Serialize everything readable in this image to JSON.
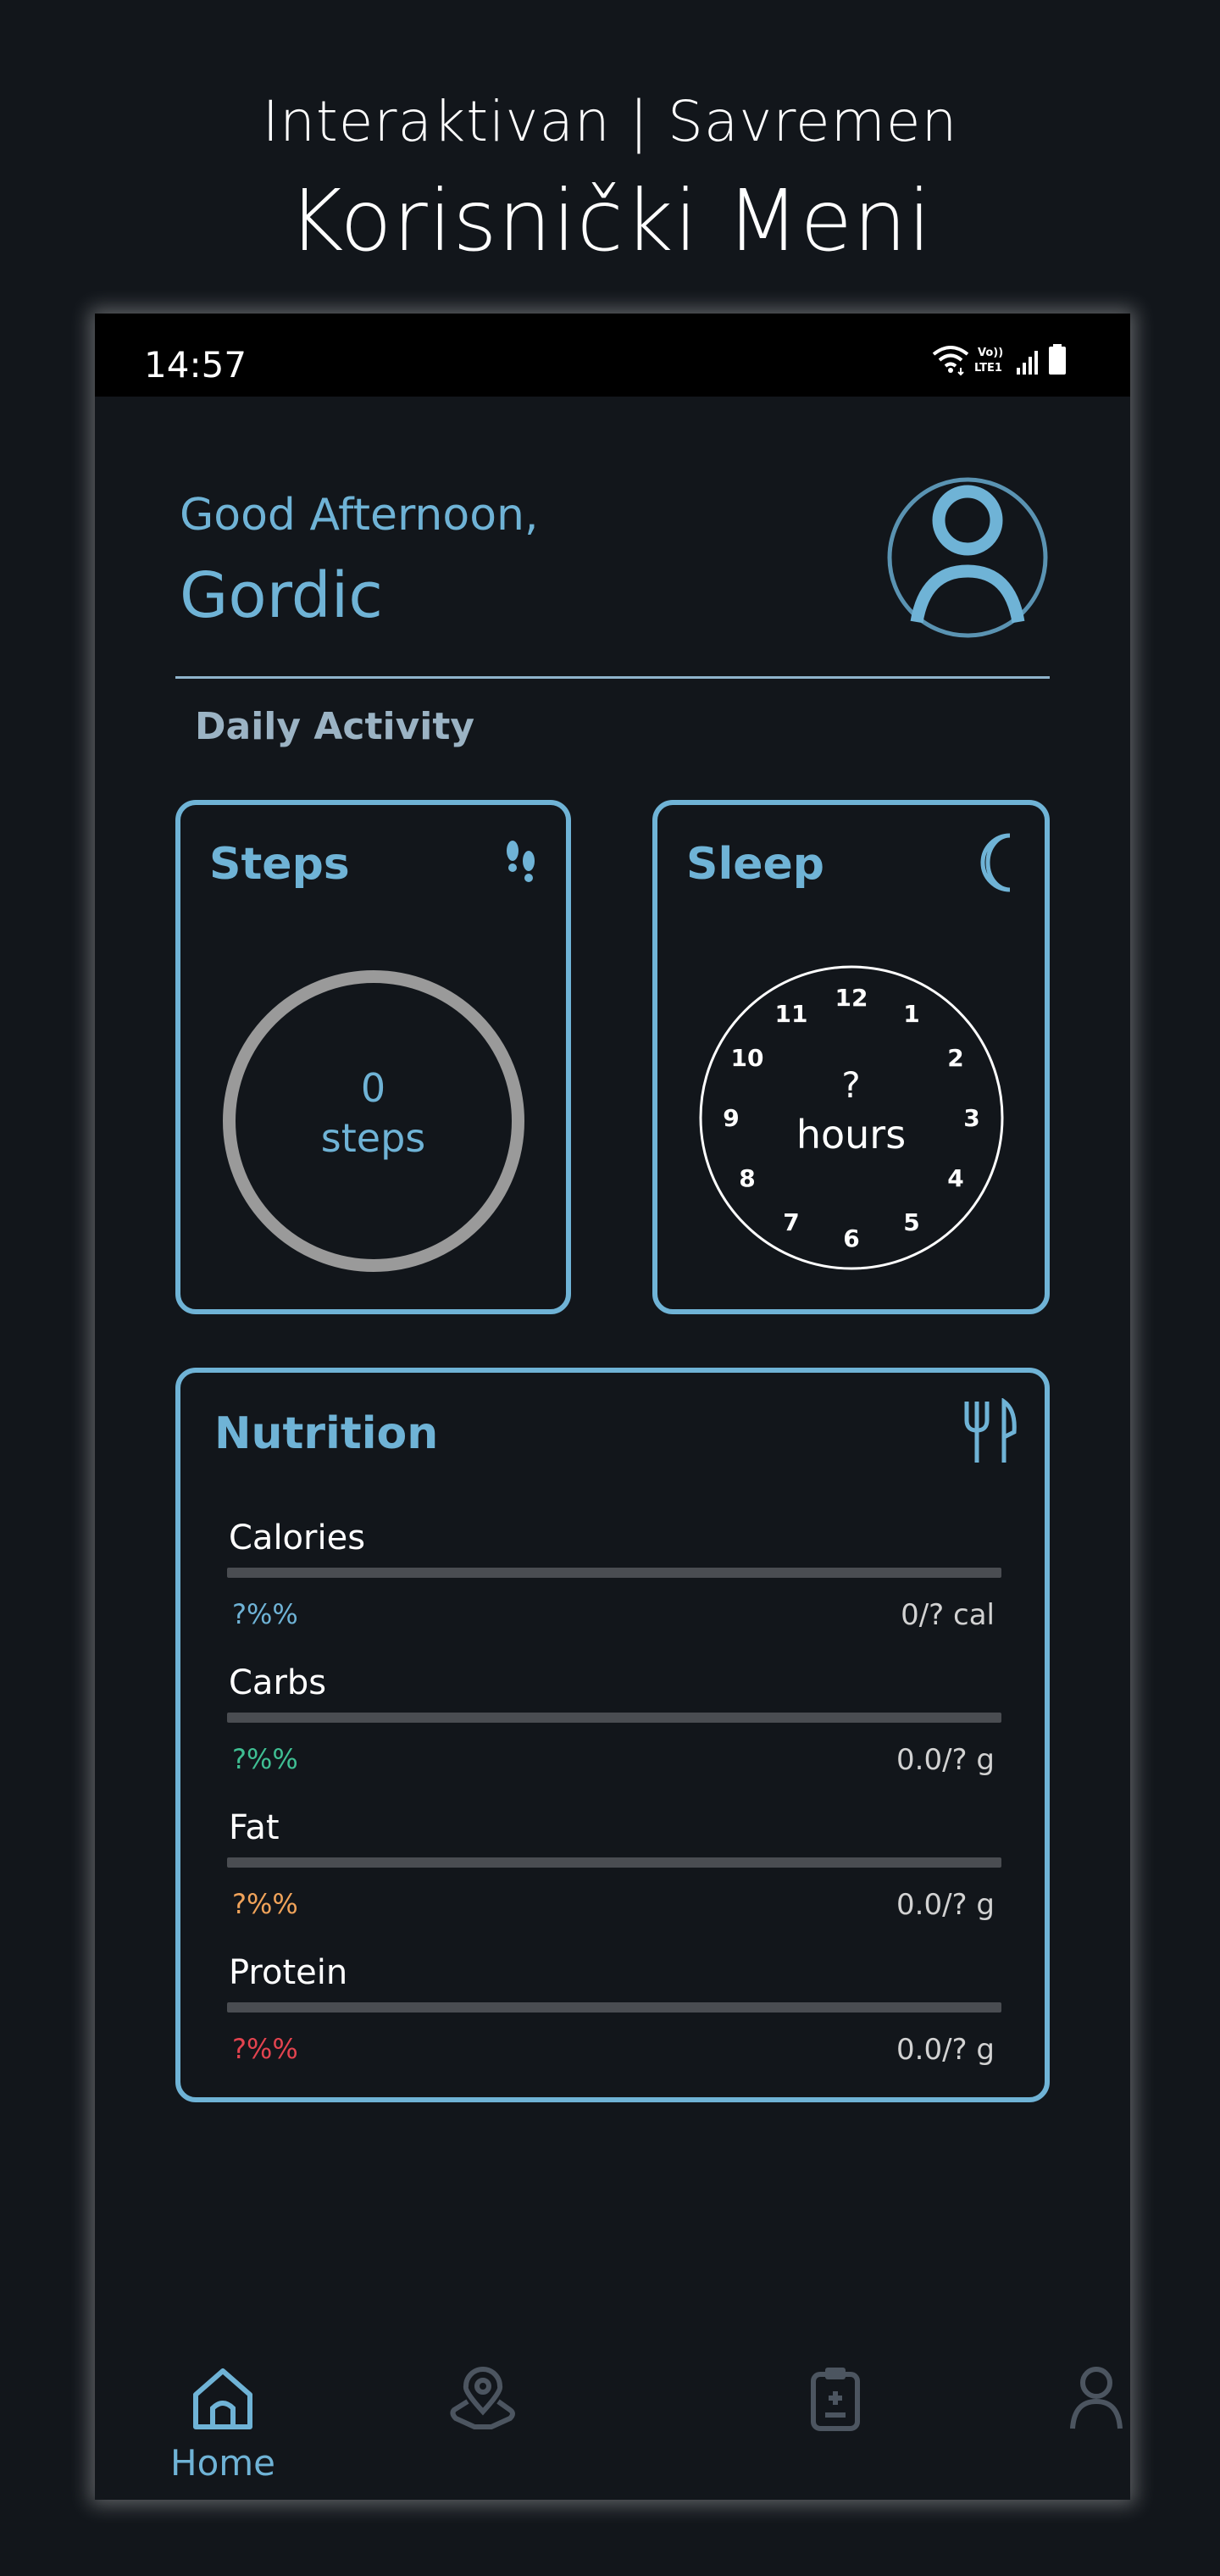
{
  "promo": {
    "line1": "Interaktivan | Savremen",
    "line2": "Korisnički Meni"
  },
  "status_bar": {
    "time": "14:57",
    "network_label_top": "Vo))",
    "network_label_bottom": "LTE1"
  },
  "header": {
    "greeting": "Good Afternoon,",
    "username": "Gordic"
  },
  "section_title": "Daily Activity",
  "steps_card": {
    "title": "Steps",
    "value": "0",
    "unit": "steps",
    "icon": "footsteps-icon"
  },
  "sleep_card": {
    "title": "Sleep",
    "value": "?",
    "unit": "hours",
    "icon": "moon-icon",
    "clock_numbers": [
      "12",
      "1",
      "2",
      "3",
      "4",
      "5",
      "6",
      "7",
      "8",
      "9",
      "10",
      "11"
    ]
  },
  "nutrition_card": {
    "title": "Nutrition",
    "icon": "fork-knife-icon",
    "rows": [
      {
        "label": "Calories",
        "percent": "?%%",
        "amount": "0/? cal",
        "color": "#6fb3d6",
        "progress": 0
      },
      {
        "label": "Carbs",
        "percent": "?%%",
        "amount": "0.0/? g",
        "color": "#3fbf93",
        "progress": 0
      },
      {
        "label": "Fat",
        "percent": "?%%",
        "amount": "0.0/? g",
        "color": "#f0a35a",
        "progress": 0
      },
      {
        "label": "Protein",
        "percent": "?%%",
        "amount": "0.0/? g",
        "color": "#e2434f",
        "progress": 0
      }
    ]
  },
  "bottom_nav": {
    "items": [
      {
        "label": "Home",
        "icon": "home-icon",
        "active": true
      },
      {
        "label": "",
        "icon": "map-pin-icon",
        "active": false
      },
      {
        "label": "",
        "icon": "clipboard-icon",
        "active": false
      },
      {
        "label": "",
        "icon": "user-icon",
        "active": false
      }
    ]
  },
  "colors": {
    "accent": "#6fb3d6",
    "background": "#12161b",
    "muted_icon": "#4c5560"
  }
}
